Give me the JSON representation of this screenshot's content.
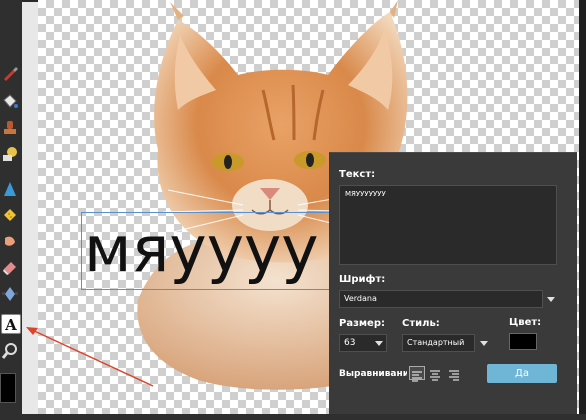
{
  "canvas": {
    "text": "мяуууу"
  },
  "toolbar": {
    "tools": [
      "brush-icon",
      "bucket-icon",
      "stamp-icon",
      "dodge-icon",
      "sharpen-icon",
      "sponge-icon",
      "smudge-icon",
      "eraser-icon",
      "transform-icon",
      "text-tool-icon",
      "zoom-icon"
    ],
    "active_tool": "text-tool-icon",
    "primary_color": "#000000"
  },
  "panel": {
    "text_label": "Текст:",
    "text_value": "МЯУУУУУУУ",
    "font_label": "Шрифт:",
    "font_value": "Verdana",
    "size_label": "Размер:",
    "size_value": "63",
    "style_label": "Стиль:",
    "style_value": "Стандартный",
    "color_label": "Цвет:",
    "color_value": "#000000",
    "align_label": "Выравнивание:",
    "align_options": [
      "left",
      "center",
      "right"
    ],
    "align_selected": "left",
    "ok_label": "Да"
  },
  "annotation": {
    "arrow_color": "#e0432a"
  }
}
